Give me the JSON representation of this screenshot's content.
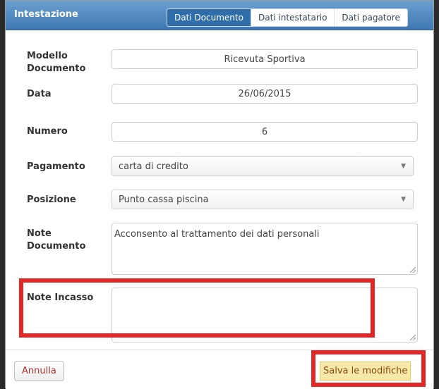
{
  "header": {
    "title": "Intestazione",
    "tabs": [
      {
        "label": "Dati Documento",
        "active": true
      },
      {
        "label": "Dati intestatario",
        "active": false
      },
      {
        "label": "Dati pagatore",
        "active": false
      }
    ]
  },
  "form": {
    "modello_label_1": "Modello",
    "modello_label_2": "Documento",
    "modello_value": "Ricevuta Sportiva",
    "data_label": "Data",
    "data_value": "26/06/2015",
    "numero_label": "Numero",
    "numero_value": "6",
    "pagamento_label": "Pagamento",
    "pagamento_value": "carta di credito",
    "posizione_label": "Posizione",
    "posizione_value": "Punto cassa piscina",
    "note_doc_label_1": "Note",
    "note_doc_label_2": "Documento",
    "note_doc_value": "Acconsento al trattamento dei dati personali",
    "note_incasso_label": "Note Incasso",
    "note_incasso_value": ""
  },
  "footer": {
    "cancel_label": "Annulla",
    "save_label": "Salva le modifiche"
  },
  "colors": {
    "header": "#3f78b2",
    "active_tab": "#2f6ea9",
    "highlight": "#e32626",
    "save_bg": "#f6e8a8"
  }
}
